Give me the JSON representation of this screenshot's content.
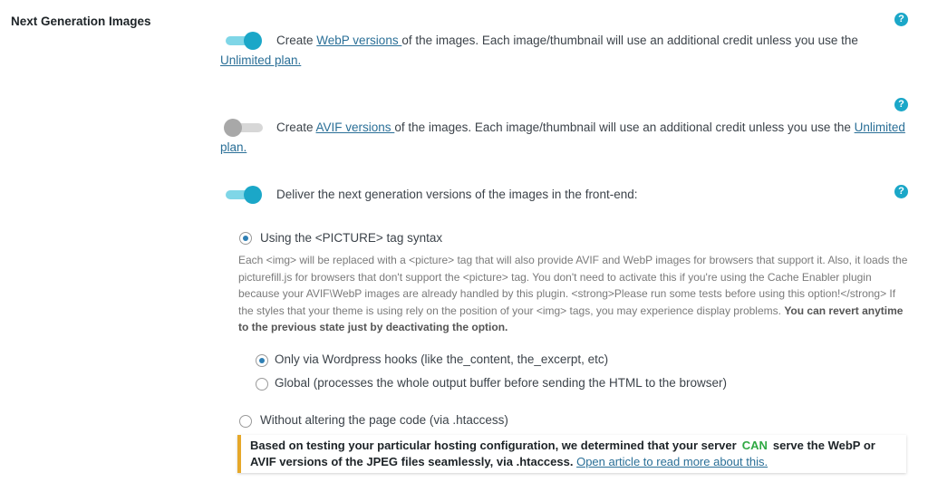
{
  "section": {
    "label": "Next Generation Images"
  },
  "webp": {
    "enabled": true,
    "text_before": "Create ",
    "link": "WebP versions ",
    "text_after": "of the images. Each image/thumbnail will use an additional credit unless you use the",
    "link2": "Unlimited plan.",
    "help_icon": "?"
  },
  "avif": {
    "enabled": false,
    "text_before": "Create ",
    "link": "AVIF versions ",
    "text_after": "of the images. Each image/thumbnail will use an additional credit unless you use the ",
    "link2a": "Unlimited",
    "link2b": "plan.",
    "help_icon": "?"
  },
  "deliver": {
    "enabled": true,
    "text": "Deliver the next generation versions of the images in the front-end:",
    "help_icon": "?"
  },
  "picture_option": {
    "selected": true,
    "label": "Using the <PICTURE> tag syntax",
    "description": "Each <img> will be replaced with a <picture> tag that will also provide AVIF and WebP images for browsers that support it. Also, it loads the picturefill.js for browsers that don't support the <picture> tag. You don't need to activate this if you're using the Cache Enabler plugin because your AVIF\\WebP images are already handled by this plugin. <strong>Please run some tests before using this option!</strong> If the styles that your theme is using rely on the position of your <img> tags, you may experience display problems. ",
    "description_bold": "You can revert anytime to the previous state just by deactivating the option.",
    "sub_options": [
      {
        "label": "Only via Wordpress hooks (like the_content, the_excerpt, etc)",
        "selected": true
      },
      {
        "label": "Global (processes the whole output buffer before sending the HTML to the browser)",
        "selected": false
      }
    ]
  },
  "htaccess_option": {
    "selected": false,
    "label": "Without altering the page code (via .htaccess)"
  },
  "notice": {
    "text_before": "Based on testing your particular hosting configuration, we determined that your server",
    "status": "CAN",
    "text_after": "serve the WebP or AVIF versions of the JPEG files seamlessly, via .htaccess. ",
    "link": "Open article to read more about this.",
    "accent_color": "#e6a82a",
    "status_color": "#2fa843"
  },
  "colors": {
    "accent": "#1ba7c8",
    "link": "#2a6f97"
  }
}
